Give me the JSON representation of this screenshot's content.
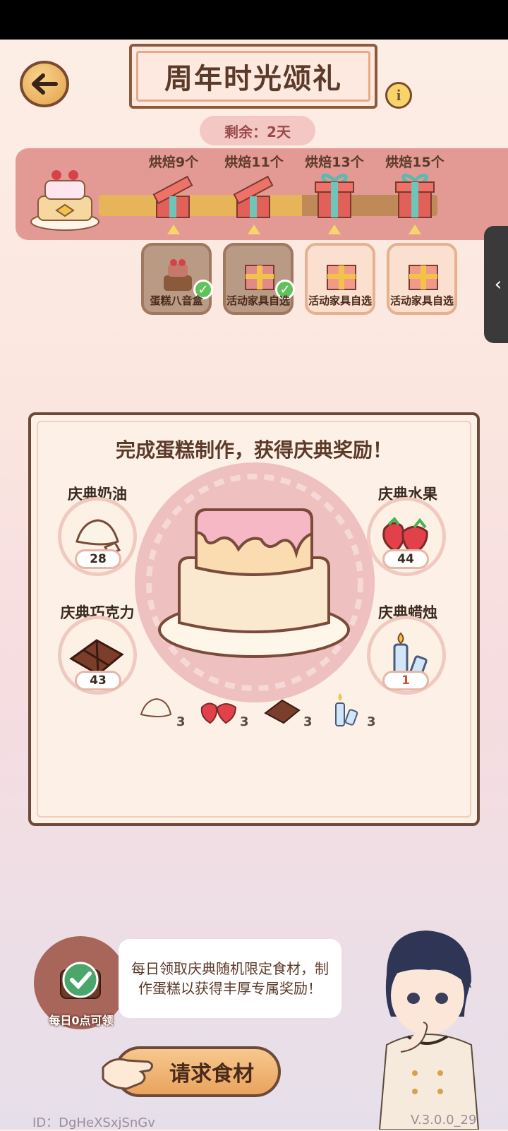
{
  "header": {
    "title": "周年时光颂礼",
    "remaining": "剩余：2天"
  },
  "milestones": [
    {
      "label": "烘焙9个",
      "reward": "蛋糕八音盒",
      "claimed": true
    },
    {
      "label": "烘焙11个",
      "reward": "活动家具自选",
      "claimed": true
    },
    {
      "label": "烘焙13个",
      "reward": "活动家具自选",
      "claimed": false
    },
    {
      "label": "烘焙15个",
      "reward": "活动家具自选",
      "claimed": false
    }
  ],
  "progress": {
    "baked": 11,
    "max": 15
  },
  "panel": {
    "title": "完成蛋糕制作，获得庆典奖励！",
    "ingredients": [
      {
        "name": "庆典奶油",
        "count": "28",
        "icon": "cream-icon"
      },
      {
        "name": "庆典水果",
        "count": "44",
        "icon": "strawberry-icon"
      },
      {
        "name": "庆典巧克力",
        "count": "43",
        "icon": "chocolate-icon"
      },
      {
        "name": "庆典蜡烛",
        "count": "1",
        "icon": "candle-icon"
      }
    ],
    "requirements": [
      "3",
      "3",
      "3",
      "3"
    ]
  },
  "daily": {
    "label": "每日0点可领",
    "tip": "每日领取庆典随机限定食材，制作蛋糕以获得丰厚专属奖励！"
  },
  "request_button": "请求食材",
  "footer": {
    "id": "ID：DgHeXSxjSnGv",
    "version": "V.3.0.0_29"
  },
  "colors": {
    "accent": "#e49a94",
    "brand_brown": "#6c4a3a",
    "progress_gold": "#e8b45a"
  }
}
